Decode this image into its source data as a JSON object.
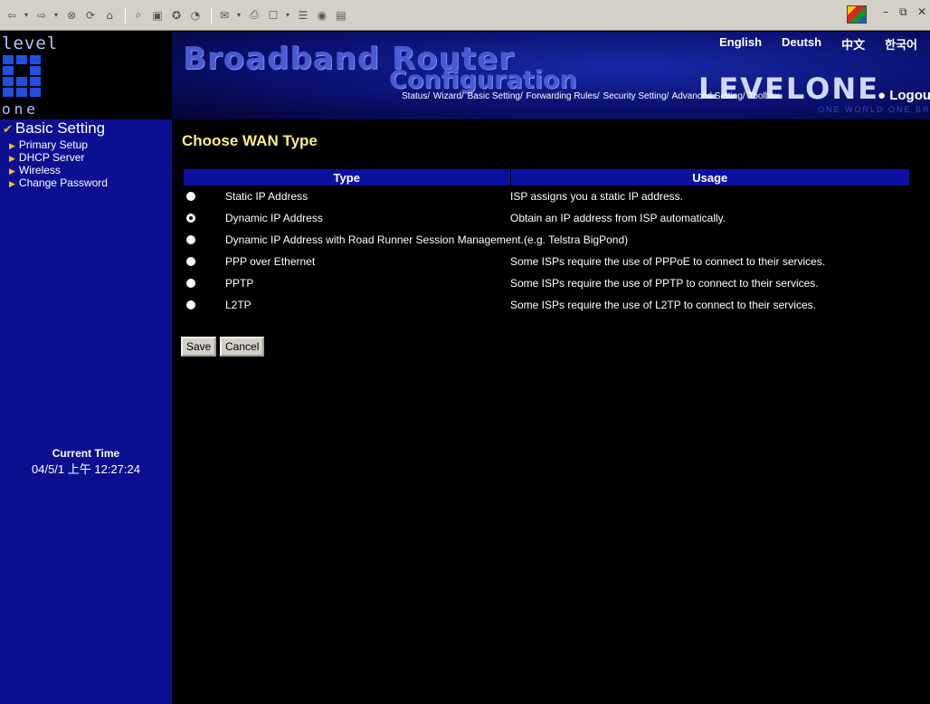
{
  "toolbar": {
    "icons": [
      "back-icon",
      "forward-icon",
      "stop-icon",
      "refresh-icon",
      "home-icon",
      "search-icon",
      "favorites-icon",
      "history-icon",
      "media-icon",
      "mail-icon",
      "print-icon",
      "edit-icon",
      "discuss-icon",
      "messenger-icon"
    ]
  },
  "brand": {
    "level": "level",
    "one": "one"
  },
  "header": {
    "title_line1": "Broadband Router",
    "title_line2": "Configuration",
    "logo": "LEVELONE",
    "slogan": "ONE WORLD ONE BRAND ONE LEVEL",
    "languages": [
      "English",
      "Deutsh",
      "中文",
      "한국어"
    ],
    "nav": [
      "Status/",
      "Wizard/",
      "Basic Setting/",
      "Forwarding Rules/",
      "Security Setting/",
      "Advanced Setting/",
      "Toolbox"
    ],
    "logout": "Logout"
  },
  "sidebar": {
    "section": "Basic Setting",
    "items": [
      "Primary Setup",
      "DHCP Server",
      "Wireless",
      "Change Password"
    ],
    "time_label": "Current Time",
    "time_value": "04/5/1 上午 12:27:24"
  },
  "main": {
    "heading": "Choose WAN Type",
    "columns": [
      "Type",
      "Usage"
    ],
    "rows": [
      {
        "type": "Static IP Address",
        "usage": "ISP assigns you a static IP address.",
        "selected": false
      },
      {
        "type": "Dynamic IP Address",
        "usage": "Obtain an IP address from ISP automatically.",
        "selected": true
      },
      {
        "type": "Dynamic IP Address with Road Runner Session Management.(e.g. Telstra BigPond)",
        "usage": "",
        "selected": false
      },
      {
        "type": "PPP over Ethernet",
        "usage": "Some ISPs require the use of PPPoE to connect to their services.",
        "selected": false
      },
      {
        "type": "PPTP",
        "usage": "Some ISPs require the use of PPTP to connect to their services.",
        "selected": false
      },
      {
        "type": "L2TP",
        "usage": "Some ISPs require the use of L2TP to connect to their services.",
        "selected": false
      }
    ],
    "save_label": "Save",
    "cancel_label": "Cancel"
  }
}
